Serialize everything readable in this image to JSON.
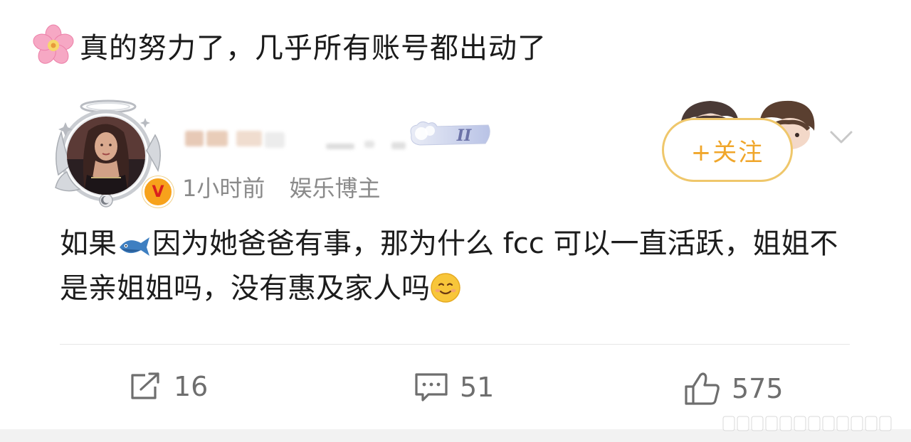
{
  "caption": {
    "icon": "cherry-blossom-emoji",
    "text": "真的努力了，几乎所有账号都出动了"
  },
  "post": {
    "author": {
      "avatar": "avatar-with-angel-frame",
      "verified_badge": "V"
    },
    "level_badge": "II",
    "meta": {
      "time": "1小时前",
      "tag": "娱乐博主"
    },
    "follow_label": "+关注",
    "body": {
      "part1": "如果",
      "emoji1": "fish-emoji",
      "part2": "因为她爸爸有事，那为什么 fcc 可以一直活跃，姐姐不是亲姐姐吗，没有惠及家人吗",
      "emoji2": "smile-emoji"
    },
    "actions": {
      "repost_count": "16",
      "comment_count": "51",
      "like_count": "575"
    }
  },
  "colors": {
    "accent": "#f0a62a",
    "follow_border": "#efc76b",
    "meta_text": "#8a8a8a",
    "divider": "#e6e6e6"
  }
}
